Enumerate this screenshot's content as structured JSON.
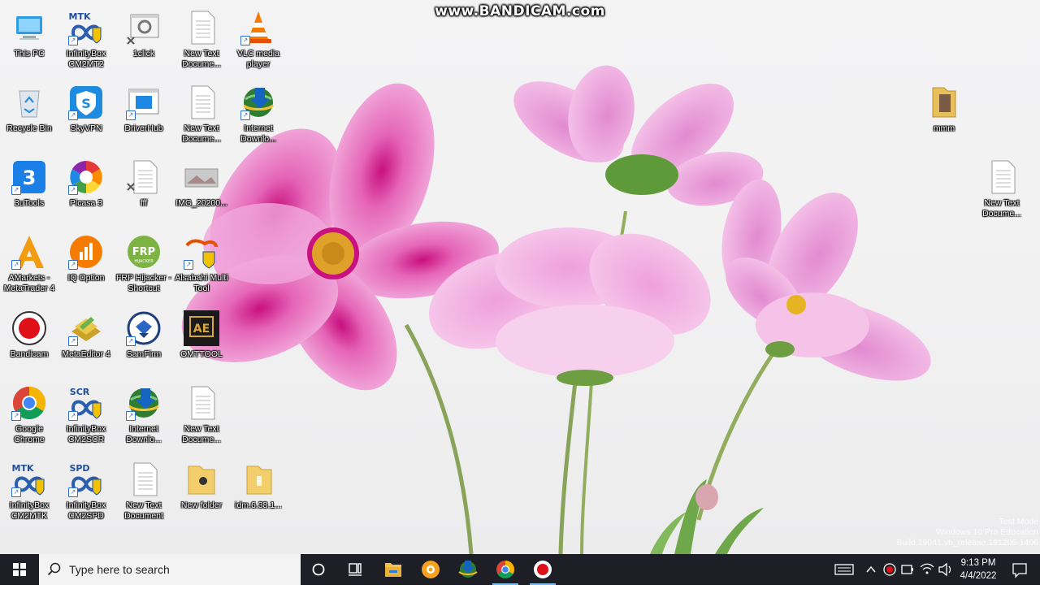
{
  "watermark": "www.BANDICAM.com",
  "desktop_icons": {
    "this_pc": "This PC",
    "infinitybox_cm2mt2": "InfinityBox CM2MT2",
    "oneclick": "1click",
    "newtext1": "New Text Docume...",
    "vlc": "VLC media player",
    "recycle_bin": "Recycle Bin",
    "skyvpn": "SkyVPN",
    "driverhub": "DriverHub",
    "newtext2": "New Text Docume...",
    "idm1": "Internet Downlo...",
    "threeutools": "3uTools",
    "picasa": "Picasa 3",
    "fff": "fff",
    "img": "IMG_20200...",
    "amarkets": "AMarkets - MetaTrader 4",
    "iqoption": "IQ Option",
    "frp": "FRP Hijacker - Shortcut",
    "alsabahi": "Alsabahi Multi Tool",
    "bandicam": "Bandicam",
    "metaeditor": "MetaEditor 4",
    "samfirm": "SamFirm",
    "omttool": "OMTTOOL",
    "chrome": "Google Chrome",
    "infinitybox_cm2scr": "InfinityBox CM2SCR",
    "idm2": "Internet Downlo...",
    "newtext3": "New Text Docume...",
    "infinitybox_cm2mtk": "InfinityBox CM2MTK",
    "infinitybox_cm2spd": "InfinityBox CM2SPD",
    "newtext4": "New Text Document",
    "newfolder": "New folder",
    "idm_setup": "idm.6.38.1...",
    "mmm": "mmm",
    "newtext5": "New Text Docume..."
  },
  "badges": {
    "mtk": "MTK",
    "scr": "SCR",
    "spd": "SPD",
    "frp": "FRP",
    "hijacker": "HIJACKER",
    "ae": "AE"
  },
  "windows_watermark": {
    "line1": "Test Mode",
    "line2": "Windows 10 Pro Education",
    "line3": "Build 19041.vb_release.191206-1406"
  },
  "taskbar": {
    "search_placeholder": "Type here to search",
    "time": "9:13 PM",
    "date": "4/4/2022"
  },
  "colors": {
    "taskbar_bg": "#1e1f26",
    "accent": "#76b9ed",
    "petal_pink": "#ef9fd8",
    "petal_center": "#d4148a"
  }
}
